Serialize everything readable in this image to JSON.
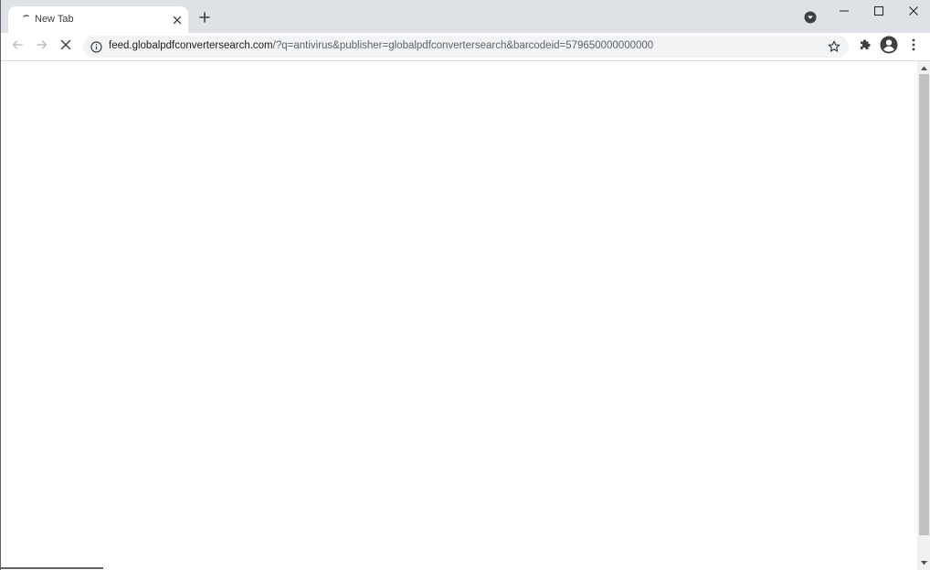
{
  "tab": {
    "title": "New Tab",
    "throbber_icon": "loading-throbber-icon",
    "close_icon": "close-icon"
  },
  "tabstrip": {
    "new_tab_icon": "plus-icon",
    "tab_search_icon": "chevron-down-circle-icon"
  },
  "window_controls": {
    "minimize_icon": "minimize-icon",
    "maximize_icon": "maximize-icon",
    "close_icon": "close-icon"
  },
  "toolbar": {
    "back_icon": "arrow-left-icon",
    "forward_icon": "arrow-right-icon",
    "stop_icon": "stop-icon",
    "extensions_icon": "puzzle-icon",
    "profile_icon": "account-circle-icon",
    "menu_icon": "kebab-menu-icon"
  },
  "omnibox": {
    "site_info_icon": "info-icon",
    "url_host": "feed.globalpdfconvertersearch.com",
    "url_path": "/?q=antivirus&publisher=globalpdfconvertersearch&barcodeid=579650000000000",
    "bookmark_icon": "star-outline-icon"
  },
  "colors": {
    "tabstrip_bg": "#dee1e6",
    "omnibox_bg": "#f1f3f4",
    "icon": "#5f6368",
    "text": "#202124",
    "scrollbar_thumb": "#c1c1c1"
  }
}
